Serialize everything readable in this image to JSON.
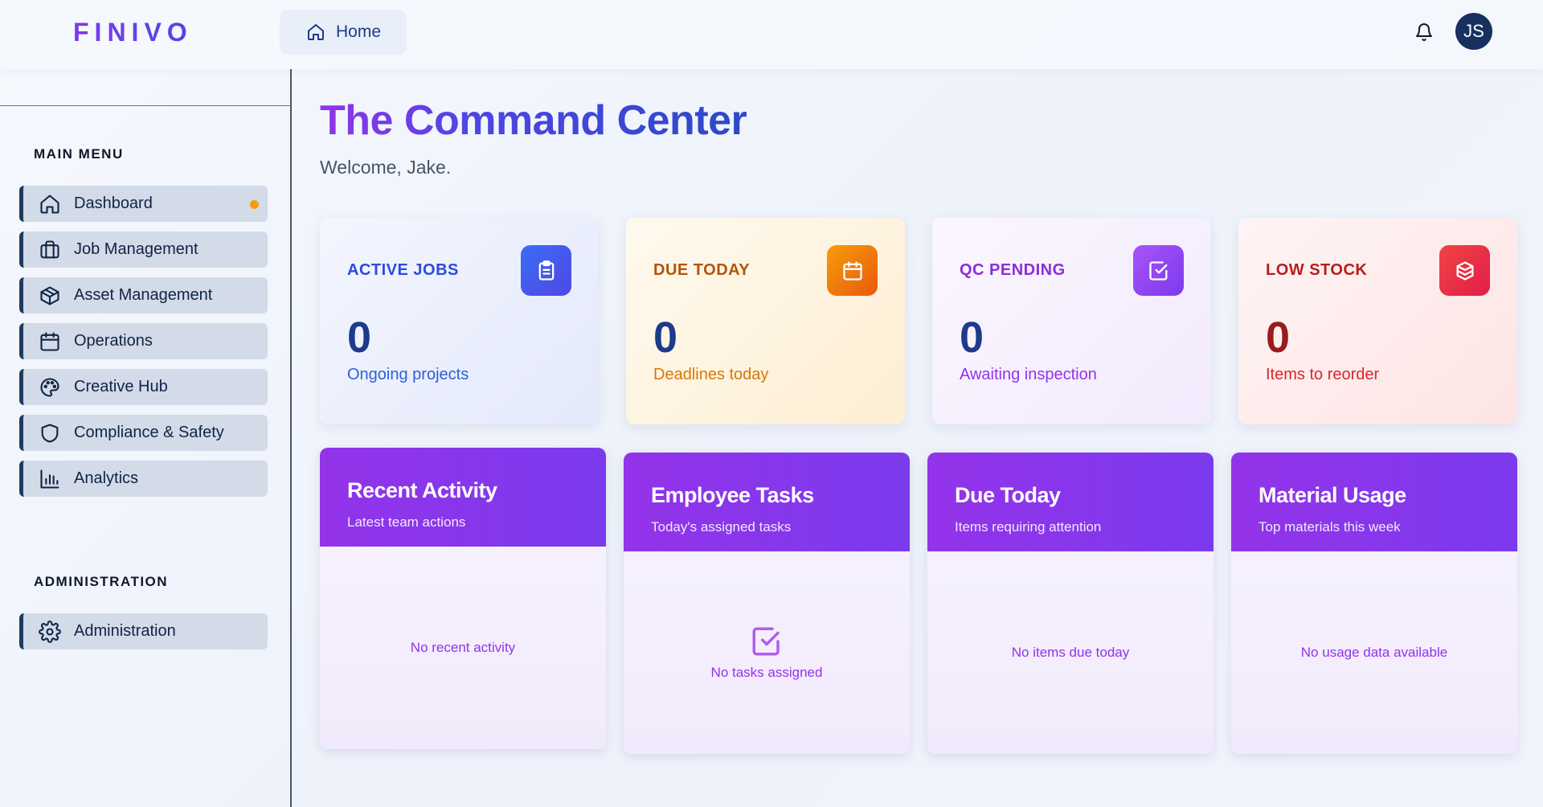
{
  "header": {
    "logo": "FINIVO",
    "home_tab": "Home",
    "avatar_initials": "JS"
  },
  "sidebar": {
    "main_menu_title": "MAIN MENU",
    "items": [
      {
        "label": "Dashboard",
        "icon": "home-icon"
      },
      {
        "label": "Job Management",
        "icon": "briefcase-icon"
      },
      {
        "label": "Asset Management",
        "icon": "package-icon"
      },
      {
        "label": "Operations",
        "icon": "calendar-icon"
      },
      {
        "label": "Creative Hub",
        "icon": "palette-icon"
      },
      {
        "label": "Compliance & Safety",
        "icon": "shield-icon"
      },
      {
        "label": "Analytics",
        "icon": "bar-chart-icon"
      }
    ],
    "admin_title": "ADMINISTRATION",
    "admin_items": [
      {
        "label": "Administration",
        "icon": "gear-icon"
      }
    ],
    "dashboard_dot_color": "#f59e0b"
  },
  "main": {
    "title": "The Command Center",
    "welcome": "Welcome, Jake.",
    "stats": [
      {
        "label": "ACTIVE JOBS",
        "value": "0",
        "sub": "Ongoing projects",
        "icon": "clipboard-icon",
        "accent": "#2d4bd8"
      },
      {
        "label": "DUE TODAY",
        "value": "0",
        "sub": "Deadlines today",
        "icon": "calendar-icon",
        "accent": "#c2590a"
      },
      {
        "label": "QC PENDING",
        "value": "0",
        "sub": "Awaiting inspection",
        "icon": "check-square-icon",
        "accent": "#8b2fd8"
      },
      {
        "label": "LOW STOCK",
        "value": "0",
        "sub": "Items to reorder",
        "icon": "boxes-icon",
        "accent": "#b91c1c"
      }
    ],
    "panels": [
      {
        "title": "Recent Activity",
        "subtitle": "Latest team actions",
        "empty": "No recent activity"
      },
      {
        "title": "Employee Tasks",
        "subtitle": "Today's assigned tasks",
        "empty": "No tasks assigned"
      },
      {
        "title": "Due Today",
        "subtitle": "Items requiring attention",
        "empty": "No items due today"
      },
      {
        "title": "Material Usage",
        "subtitle": "Top materials this week",
        "empty": "No usage data available"
      }
    ]
  }
}
